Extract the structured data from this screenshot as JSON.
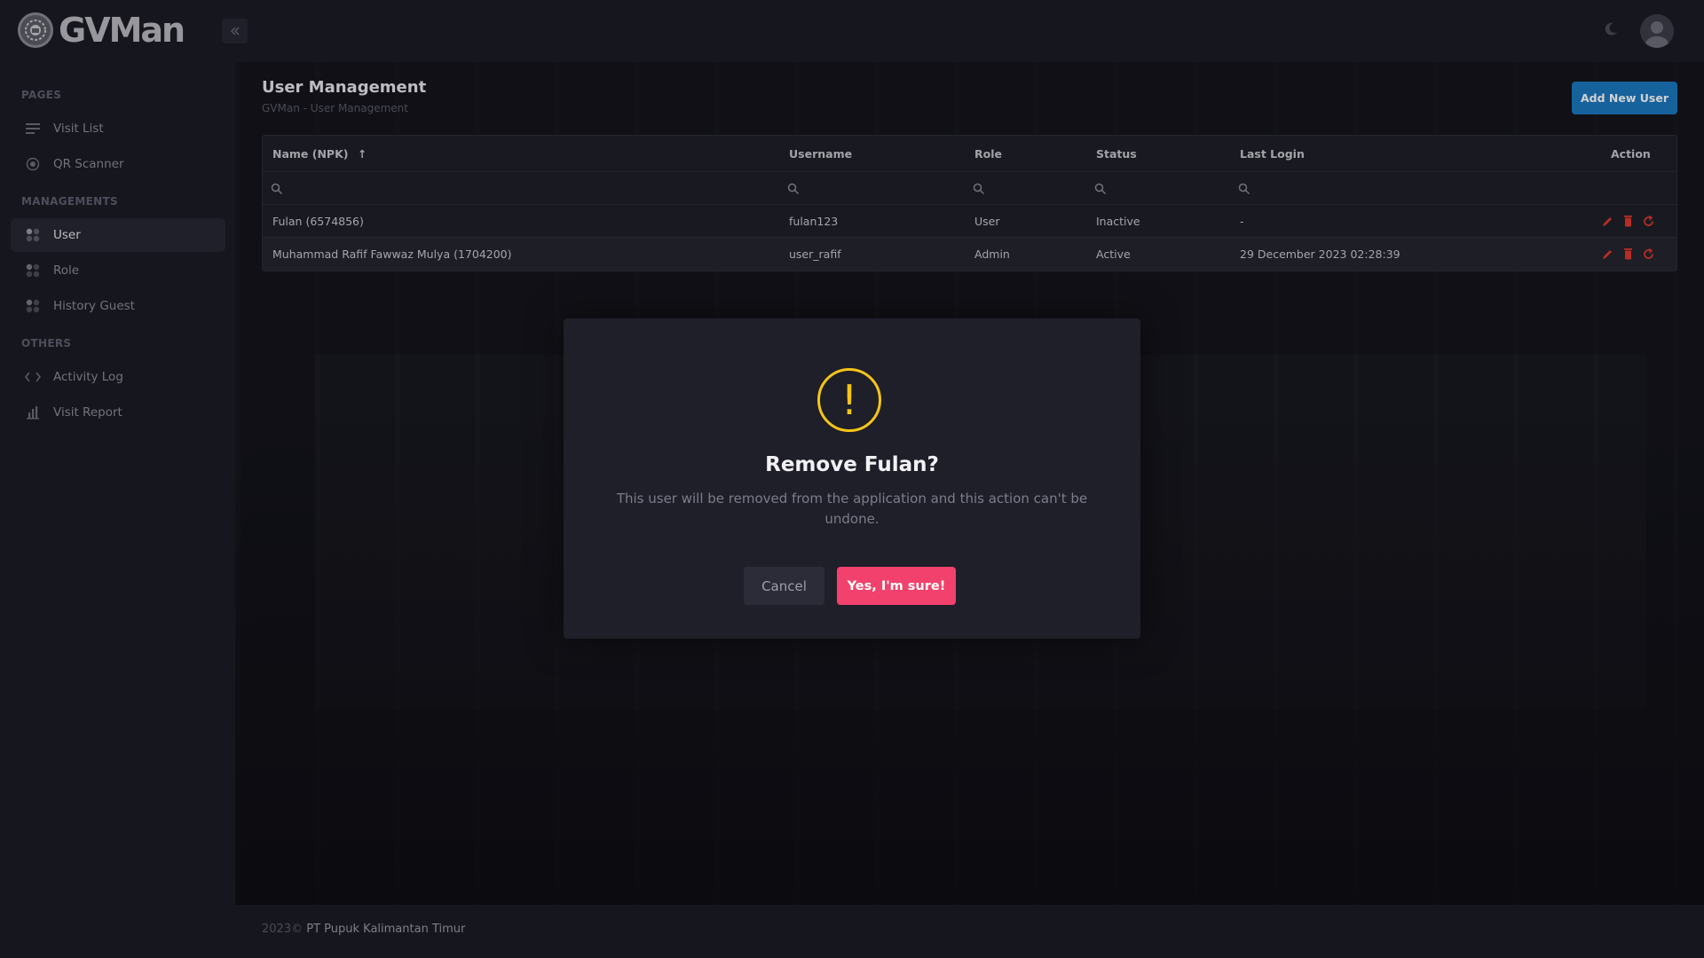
{
  "app": {
    "name": "GVMan"
  },
  "sidebar": {
    "sections": [
      {
        "label": "PAGES"
      },
      {
        "label": "MANAGEMENTS"
      },
      {
        "label": "OTHERS"
      }
    ],
    "items": [
      {
        "label": "Visit List",
        "icon": "list-icon"
      },
      {
        "label": "QR Scanner",
        "icon": "qr-target-icon"
      },
      {
        "label": "User",
        "icon": "grid-dots-icon",
        "active": true
      },
      {
        "label": "Role",
        "icon": "grid-dots-icon"
      },
      {
        "label": "History Guest",
        "icon": "grid-dots-icon"
      },
      {
        "label": "Activity Log",
        "icon": "code-icon"
      },
      {
        "label": "Visit Report",
        "icon": "bar-chart-icon"
      }
    ]
  },
  "header": {
    "title": "User Management",
    "breadcrumb": "GVMan - User Management",
    "add_button": "Add New User"
  },
  "table": {
    "columns": [
      "Name (NPK)",
      "Username",
      "Role",
      "Status",
      "Last Login",
      "Action"
    ],
    "sort_indicator": "↑",
    "rows": [
      {
        "name": "Fulan (6574856)",
        "username": "fulan123",
        "role": "User",
        "status": "Inactive",
        "last_login": "-"
      },
      {
        "name": "Muhammad Rafif Fawwaz Mulya (1704200)",
        "username": "user_rafif",
        "role": "Admin",
        "status": "Active",
        "last_login": "29 December 2023 02:28:39"
      }
    ]
  },
  "footer": {
    "year": "2023©",
    "company": "PT Pupuk Kalimantan Timur"
  },
  "modal": {
    "icon": "!",
    "title": "Remove Fulan?",
    "text": "This user will be removed from the application and this action can't be undone.",
    "cancel": "Cancel",
    "confirm": "Yes, I'm sure!"
  },
  "colors": {
    "primary": "#1c78c0",
    "danger": "#f1416c",
    "warning": "#f5c518",
    "action_red": "#e0362c"
  }
}
